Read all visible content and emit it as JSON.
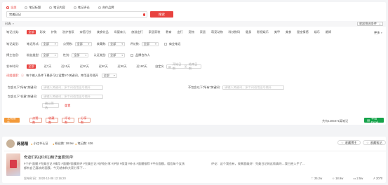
{
  "search_modes": [
    {
      "label": "全部",
      "selected": true
    },
    {
      "label": "笔记标题",
      "selected": false
    },
    {
      "label": "笔记内容",
      "selected": false
    },
    {
      "label": "笔记评论",
      "selected": false
    },
    {
      "label": "合作品牌",
      "selected": false
    }
  ],
  "search": {
    "value": "完美日记",
    "button": "搜索"
  },
  "filter_bar": {
    "label": "已选",
    "collapse": "收起筛选条件"
  },
  "category": {
    "label": "笔记分类:",
    "tags": [
      "全部",
      "彩妆",
      "护肤",
      "洗护香氛",
      "穿搭打扮",
      "美食饮品",
      "母婴育儿",
      "旅游出行",
      "家居家装",
      "教育",
      "出行",
      "宠物",
      "家居",
      "萌宠动物",
      "科技数码",
      "健身",
      "影视娱乐",
      "美甲",
      "美食",
      "星座情感",
      "娱乐",
      "婚嫁"
    ],
    "more": "更多"
  },
  "note_type": {
    "label": "笔记类型:",
    "selects": [
      {
        "label": "笔记形式:",
        "value": "全部"
      },
      {
        "label": "点赞数:",
        "value": "全部"
      },
      {
        "label": "收藏数:",
        "value": "全部"
      },
      {
        "label": "评论数:",
        "value": "全部"
      }
    ],
    "checkbox": "商业笔记"
  },
  "blogger": {
    "label": "博主信息:",
    "selects": [
      {
        "label": "粉丝类型:",
        "value": "全部"
      },
      {
        "label": "性别:",
        "value": "全部"
      },
      {
        "label": "认证类型:",
        "value": "全部"
      }
    ],
    "checkbox": "品牌合作人"
  },
  "time": {
    "label": "发布时间:",
    "options": [
      "全部",
      "近7天",
      "近15天",
      "近30天",
      "近60天",
      "近90天",
      "近180天"
    ],
    "custom_label": "自定义",
    "start": "开始日期",
    "sep": "至",
    "end": "结束日期"
  },
  "keyword_search": {
    "label": "词组搜索:",
    "hint": "每个输入条件下最多可以设置5个关键词，并用逗号隔开",
    "mode": "全部"
  },
  "keywords": {
    "include_all_label": "包含以下\"所有\"关键词:",
    "include_all_placeholder": "请输入关键词，多个词语用逗号隔开",
    "include_any_label": "包含以下\"任意\"关键词:",
    "include_any_placeholder": "请输入关键词，多个词语用逗号隔开",
    "exclude_label": "不包含以下\"所有\"关键词:",
    "exclude_placeholder": "请输入关键词，多个词语用逗号隔开",
    "confirm": "确认筛选",
    "reset": "重置"
  },
  "actions": {
    "primary": "生成报告",
    "buttons": [
      "点赞数",
      "收藏数",
      "评论数",
      "分享数"
    ],
    "count_text": "共有1285871篇笔记",
    "export": "导出Excel"
  },
  "result": {
    "blogger_name": "网易精",
    "blogger_badge": "小红书认证",
    "blogger_followers": "粉丝数: 18.9w",
    "blogger_notes": "笔记数: 436",
    "follow_btn": "收藏博主",
    "collect_btn": "收藏笔记",
    "title": "奇迹们的{{红红}}精华面膜测评!",
    "desc": "#个护 面膜 #完美日记 #精华 #面膜#面膜测评 #完美日记 #好物分享 #护肤 #保湿 #补水 #面膜推荐 #平价面膜，相信每个女孩都有自己喜欢的面膜，今天就来和大家分享下…",
    "comment": "评论：这个我也有，效果超级好！完美日记的这款真的…我已经入手了…",
    "time": "发布时间：2020-12-08 12:16:20",
    "stats": [
      "25.2w",
      "18.9w",
      "2.5w",
      "2070"
    ]
  },
  "colors": {
    "accent": "#e8423f",
    "orange": "#f39a3a",
    "green": "#15a34a"
  }
}
